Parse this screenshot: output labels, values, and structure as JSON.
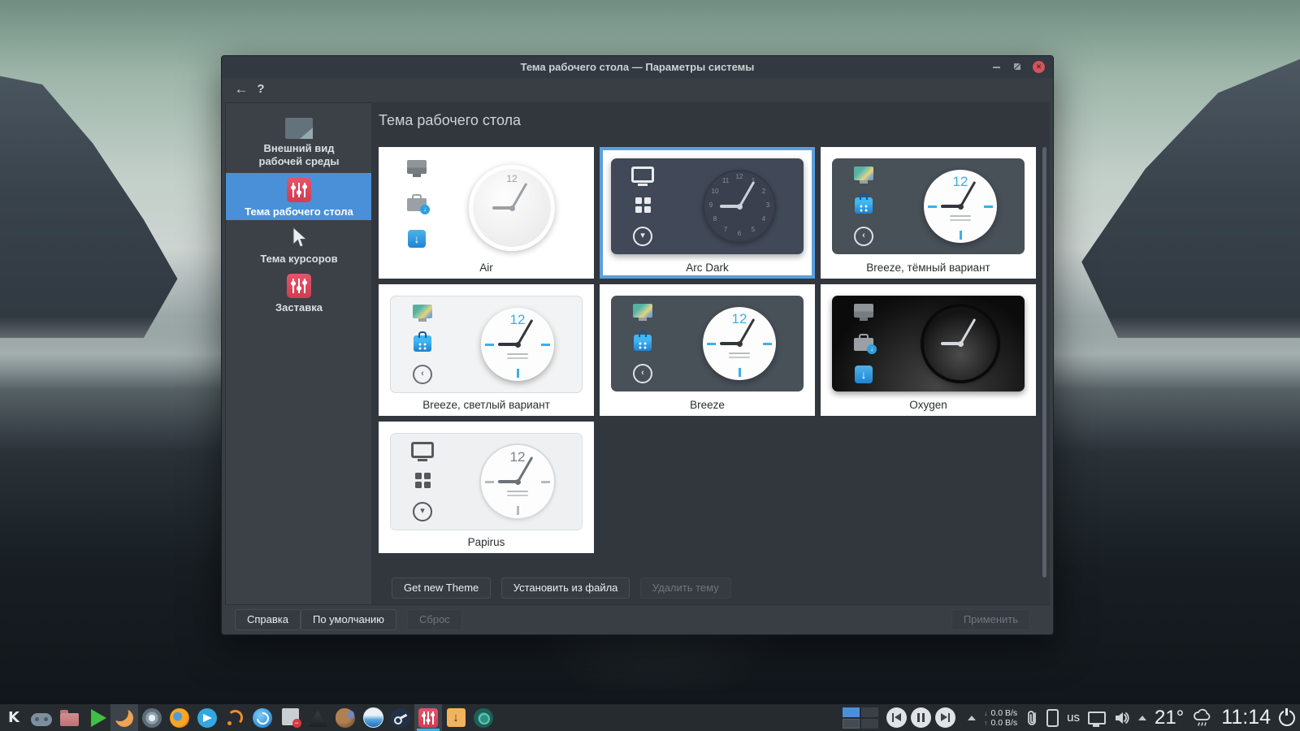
{
  "window": {
    "title": "Тема рабочего стола — Параметры системы",
    "titlebar_icons": [
      "minimize-icon",
      "restore-icon",
      "close-icon"
    ],
    "toolbar": {
      "back": "←",
      "help": "?"
    }
  },
  "sidebar": {
    "items": [
      {
        "label": "Внешний вид рабочей среды",
        "label_line1": "Внешний вид",
        "label_line2": "рабочей среды",
        "icon": "desktop-appearance-icon",
        "selected": false
      },
      {
        "label": "Тема рабочего стола",
        "icon": "sliders-icon",
        "selected": true
      },
      {
        "label": "Тема курсоров",
        "icon": "cursor-icon",
        "selected": false
      },
      {
        "label": "Заставка",
        "icon": "sliders-icon",
        "selected": false
      }
    ]
  },
  "content": {
    "heading": "Тема рабочего стола",
    "preview_clock_numeral": "12",
    "arc_numerals": [
      "12",
      "1",
      "2",
      "3",
      "4",
      "5",
      "6",
      "7",
      "8",
      "9",
      "10",
      "11"
    ],
    "themes": [
      {
        "name": "Air",
        "variant": "light",
        "selected": false
      },
      {
        "name": "Arc Dark",
        "variant": "dark",
        "selected": true
      },
      {
        "name": "Breeze, тёмный вариант",
        "variant": "dark",
        "selected": false
      },
      {
        "name": "Breeze, светлый вариант",
        "variant": "light",
        "selected": false
      },
      {
        "name": "Breeze",
        "variant": "dark",
        "selected": false
      },
      {
        "name": "Oxygen",
        "variant": "black",
        "selected": false
      },
      {
        "name": "Papirus",
        "variant": "light",
        "selected": false
      }
    ],
    "actions": {
      "get_new": "Get new Theme",
      "install": "Установить из файла",
      "delete": "Удалить тему",
      "delete_enabled": false
    }
  },
  "footer": {
    "help": "Справка",
    "defaults": "По умолчанию",
    "reset": "Сброс",
    "apply": "Применить",
    "reset_enabled": false,
    "apply_enabled": false
  },
  "taskbar": {
    "apps": [
      "kde-launcher",
      "gamepad",
      "file-manager",
      "play-store",
      "crescent-app",
      "chromium",
      "firefox",
      "telegram",
      "rss-reader",
      "torrent-client",
      "package-updater",
      "inkscape",
      "pet-app",
      "paint-app",
      "steam",
      "system-settings",
      "download-manager",
      "network-app"
    ],
    "active_apps": [
      "crescent-app",
      "system-settings"
    ],
    "tray": {
      "pager_desktops": 4,
      "media_controls": [
        "previous",
        "pause",
        "next"
      ],
      "net_down": "0.0 B/s",
      "net_up": "0.0 B/s",
      "keyboard_layout": "us",
      "temperature": "21°",
      "time": "11:14"
    }
  },
  "colors": {
    "accent": "#3daee9",
    "selection_blue": "#4a90d9",
    "selected_card_border": "#5b9fdc",
    "window_bg": "#383e44",
    "content_bg": "#31373d",
    "card_bg": "#ffffff",
    "close_button": "#d75259",
    "taskbar_bg": "#262b30",
    "settings_icon_red": "#da4453"
  }
}
